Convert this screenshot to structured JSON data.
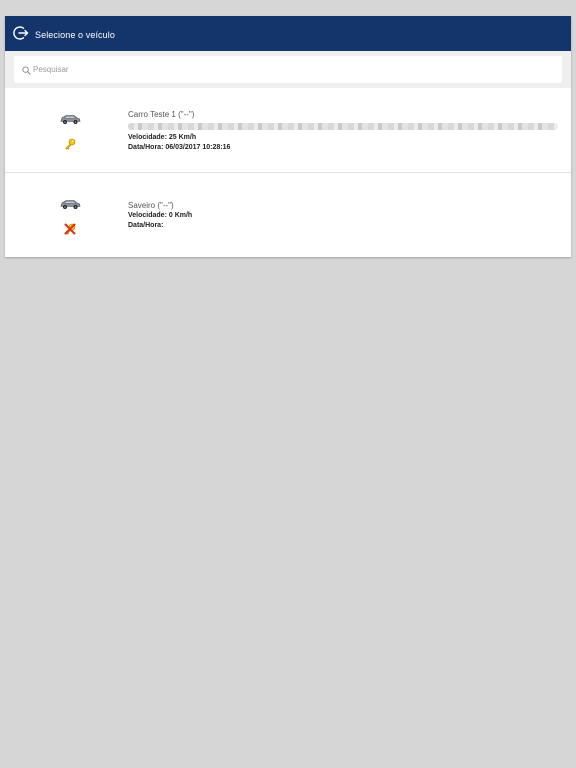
{
  "header": {
    "title": "Selecione o veículo",
    "back_icon": "logout-arrow-icon"
  },
  "search": {
    "placeholder": "Pesquisar",
    "value": "",
    "icon": "search-icon"
  },
  "vehicles": [
    {
      "name": "Carro Teste 1 (\"--\")",
      "address": "",
      "speed_label": "Velocidade:",
      "speed_value": "25 Km/h",
      "datetime_label": "Data/Hora:",
      "datetime_value": "06/03/2017 10:28:16",
      "vehicle_icon": "car-icon",
      "status_icon": "ignition-key-on-icon",
      "status_color": "#f0b400"
    },
    {
      "name": "Saveiro (\"--\")",
      "speed_label": "Velocidade:",
      "speed_value": "0 Km/h",
      "datetime_label": "Data/Hora:",
      "datetime_value": "",
      "vehicle_icon": "car-icon",
      "status_icon": "ignition-key-off-icon",
      "status_color": "#e04020"
    }
  ],
  "colors": {
    "header_bg": "#14356b",
    "page_bg": "#d6d6d6"
  }
}
